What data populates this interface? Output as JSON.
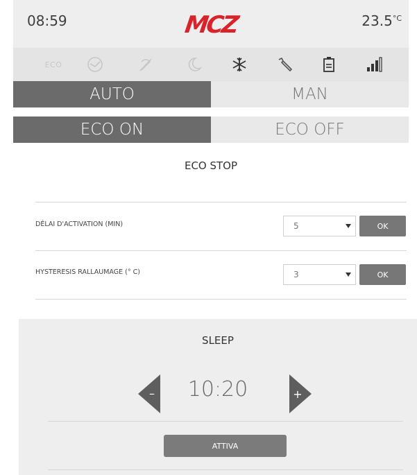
{
  "header": {
    "time": "08:59",
    "brand": "MCZ",
    "temperature": "23.5",
    "unit": "°C"
  },
  "status_icons": [
    {
      "name": "eco-label",
      "text": "ECO"
    },
    {
      "name": "clock-icon"
    },
    {
      "name": "fan-off-icon"
    },
    {
      "name": "moon-icon"
    },
    {
      "name": "snowflake-icon"
    },
    {
      "name": "wrench-icon"
    },
    {
      "name": "tank-icon"
    },
    {
      "name": "signal-icon"
    }
  ],
  "mode": {
    "auto": "AUTO",
    "man": "MAN",
    "selected": "AUTO"
  },
  "eco": {
    "on": "ECO ON",
    "off": "ECO OFF",
    "selected": "ECO ON"
  },
  "eco_stop": {
    "title": "ECO STOP",
    "rows": [
      {
        "label": "DÉLAI D'ACTIVATION (MIN)",
        "value": "5",
        "button": "OK"
      },
      {
        "label": "HYSTERESIS RALLAUMAGE (° C)",
        "value": "3",
        "button": "OK"
      }
    ]
  },
  "sleep": {
    "title": "SLEEP",
    "time": "10:20",
    "decrement": "–",
    "increment": "+",
    "button": "ATTIVA"
  }
}
